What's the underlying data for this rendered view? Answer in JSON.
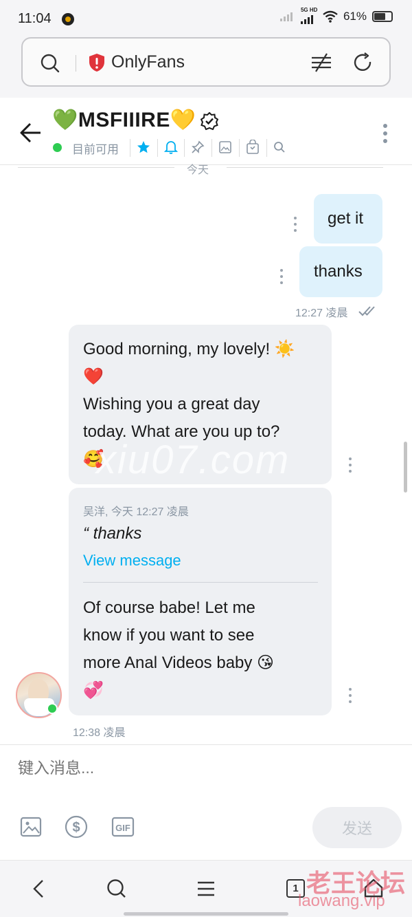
{
  "status_bar": {
    "time": "11:04",
    "network": "5G HD",
    "battery": "61%"
  },
  "browser": {
    "url_text": "OnlyFans"
  },
  "chat_header": {
    "title": "💚MSFIIIRE💛",
    "availability": "目前可用"
  },
  "date_divider": "今天",
  "messages_out": [
    {
      "text": "get it"
    },
    {
      "text": "thanks"
    }
  ],
  "out_meta": "12:27 凌晨",
  "incoming": {
    "message1_lines": [
      "Good morning, my lovely! ☀️",
      "❤️",
      "Wishing you a great day",
      "today. What are you up to?",
      "🥰"
    ],
    "quote_meta": "吴洋, 今天 12:27 凌晨",
    "quote_text": "“ thanks",
    "view_message": "View message",
    "message2_lines": [
      "Of course babe! Let me",
      "know if you want to see",
      "more Anal Videos baby 😘",
      "💞"
    ],
    "time": "12:38 凌晨"
  },
  "composer": {
    "placeholder": "键入消息...",
    "send_label": "发送"
  },
  "watermarks": {
    "overlay": "xiu07.com",
    "forum_name": "老王论坛",
    "forum_url": "laowang.vip"
  },
  "nav": {
    "tab_count": "1"
  },
  "colors": {
    "accent": "#00aff0",
    "online": "#2ecc52",
    "bubble_out": "#dff2fc",
    "bubble_in": "#eef0f3"
  }
}
